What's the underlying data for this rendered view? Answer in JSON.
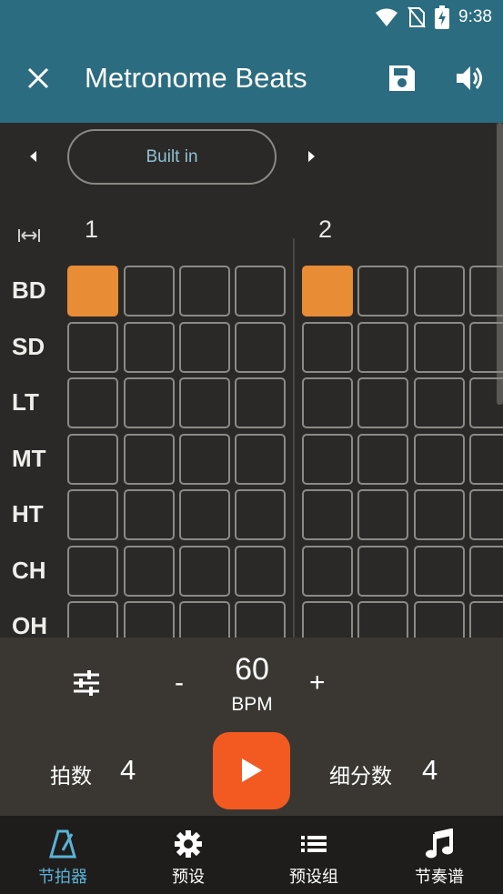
{
  "status": {
    "time": "9:38"
  },
  "appbar": {
    "title": "Metronome Beats"
  },
  "selector": {
    "value": "Built in"
  },
  "measures": [
    "1",
    "2"
  ],
  "rows": [
    {
      "label": "BD",
      "active": [
        0,
        4
      ]
    },
    {
      "label": "SD",
      "active": []
    },
    {
      "label": "LT",
      "active": []
    },
    {
      "label": "MT",
      "active": []
    },
    {
      "label": "HT",
      "active": []
    },
    {
      "label": "CH",
      "active": []
    },
    {
      "label": "OH",
      "active": []
    }
  ],
  "controls": {
    "minus": "-",
    "bpm": "60",
    "bpm_unit": "BPM",
    "plus": "+",
    "beats_label": "拍数",
    "beats_value": "4",
    "subdiv_label": "细分数",
    "subdiv_value": "4"
  },
  "nav": [
    {
      "label": "节拍器",
      "icon": "metronome-icon",
      "active": true
    },
    {
      "label": "预设",
      "icon": "gear-icon",
      "active": false
    },
    {
      "label": "预设组",
      "icon": "list-icon",
      "active": false
    },
    {
      "label": "节奏谱",
      "icon": "music-note-icon",
      "active": false
    }
  ],
  "colors": {
    "appbar": "#2b6c80",
    "accent_cell": "#e88c35",
    "play": "#f25a22",
    "nav_active": "#5ab3d6"
  }
}
